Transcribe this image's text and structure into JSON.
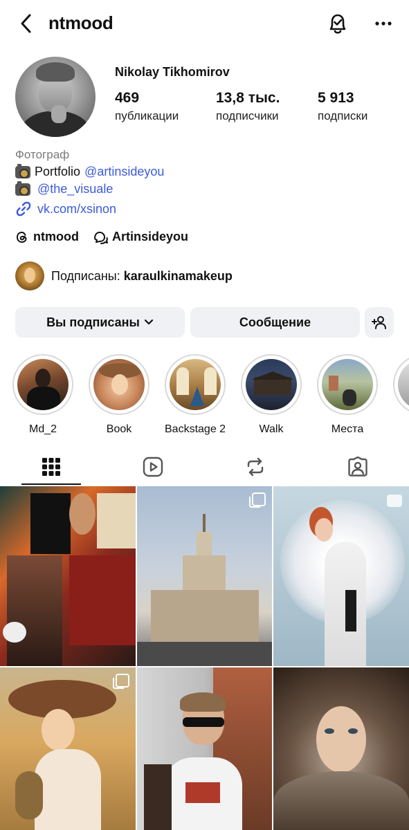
{
  "header": {
    "username": "ntmood",
    "back_icon": "chevron-left-icon",
    "bell_icon": "bell-check-icon",
    "more_icon": "more-horizontal-icon"
  },
  "profile": {
    "full_name": "Nikolay Tikhomirov",
    "stats": [
      {
        "value": "469",
        "label": "публикации"
      },
      {
        "value": "13,8 тыс.",
        "label": "подписчики"
      },
      {
        "value": "5 913",
        "label": "подписки"
      }
    ]
  },
  "bio": {
    "category": "Фотограф",
    "line1_text": "Portfolio",
    "line1_mention": "@artinsideyou",
    "line2_mention": "@the_visuale",
    "link": "vk.com/xsinon"
  },
  "threads": {
    "handle": "ntmood",
    "channel": "Artinsideyou"
  },
  "followed_by": {
    "prefix": "Подписаны:",
    "name": "karaulkinamakeup"
  },
  "actions": {
    "following_label": "Вы подписаны",
    "message_label": "Сообщение"
  },
  "highlights": [
    {
      "label": "Md_2"
    },
    {
      "label": "Book"
    },
    {
      "label": "Backstage 2"
    },
    {
      "label": "Walk"
    },
    {
      "label": "Места"
    }
  ],
  "tabs": [
    "grid-icon",
    "reels-icon",
    "reposts-icon",
    "tagged-icon"
  ],
  "colors": {
    "link": "#3b5bdb",
    "button_bg": "#eff1f4",
    "text": "#111111",
    "muted": "#7a7a7a"
  }
}
